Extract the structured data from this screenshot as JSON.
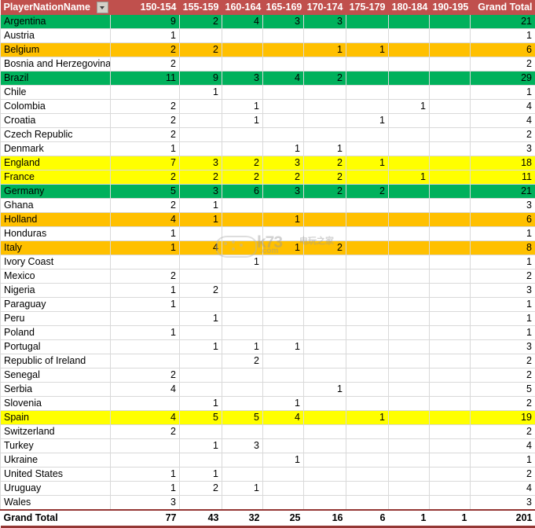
{
  "header": {
    "name_label": "PlayerNationName",
    "filter_icon": "chevron-down-icon",
    "columns": [
      "150-154",
      "155-159",
      "160-164",
      "165-169",
      "170-174",
      "175-179",
      "180-184",
      "190-195"
    ],
    "grand_total_label": "Grand Total",
    "bg_color": "#c0504d",
    "text_color": "#ffffff"
  },
  "highlight_colors": {
    "green": "#00b15c",
    "orange": "#ffc000",
    "yellow": "#ffff00",
    "none": "#ffffff"
  },
  "watermark": {
    "text": "k73",
    "sub": ".com",
    "cn": "电玩之家"
  },
  "chart_data": {
    "type": "table",
    "title": "PlayerNationName by height band",
    "categories": [
      "150-154",
      "155-159",
      "160-164",
      "165-169",
      "170-174",
      "175-179",
      "180-184",
      "190-195"
    ],
    "row_label": "PlayerNationName",
    "total_label": "Grand Total",
    "grand_total_row": {
      "name": "Grand Total",
      "values": [
        "77",
        "43",
        "32",
        "25",
        "16",
        "6",
        "1",
        "1"
      ],
      "total": "201"
    },
    "rows": [
      {
        "name": "Argentina",
        "highlight": "green",
        "values": [
          "9",
          "2",
          "4",
          "3",
          "3",
          "",
          "",
          ""
        ],
        "total": "21"
      },
      {
        "name": "Austria",
        "highlight": "none",
        "values": [
          "1",
          "",
          "",
          "",
          "",
          "",
          "",
          ""
        ],
        "total": "1"
      },
      {
        "name": "Belgium",
        "highlight": "orange",
        "values": [
          "2",
          "2",
          "",
          "",
          "1",
          "1",
          "",
          ""
        ],
        "total": "6"
      },
      {
        "name": "Bosnia and Herzegovina",
        "highlight": "none",
        "values": [
          "2",
          "",
          "",
          "",
          "",
          "",
          "",
          ""
        ],
        "total": "2"
      },
      {
        "name": "Brazil",
        "highlight": "green",
        "values": [
          "11",
          "9",
          "3",
          "4",
          "2",
          "",
          "",
          ""
        ],
        "total": "29"
      },
      {
        "name": "Chile",
        "highlight": "none",
        "values": [
          "",
          "1",
          "",
          "",
          "",
          "",
          "",
          ""
        ],
        "total": "1"
      },
      {
        "name": "Colombia",
        "highlight": "none",
        "values": [
          "2",
          "",
          "1",
          "",
          "",
          "",
          "1",
          ""
        ],
        "total": "4"
      },
      {
        "name": "Croatia",
        "highlight": "none",
        "values": [
          "2",
          "",
          "1",
          "",
          "",
          "1",
          "",
          ""
        ],
        "total": "4"
      },
      {
        "name": "Czech Republic",
        "highlight": "none",
        "values": [
          "2",
          "",
          "",
          "",
          "",
          "",
          "",
          ""
        ],
        "total": "2"
      },
      {
        "name": "Denmark",
        "highlight": "none",
        "values": [
          "1",
          "",
          "",
          "1",
          "1",
          "",
          "",
          ""
        ],
        "total": "3"
      },
      {
        "name": "England",
        "highlight": "yellow",
        "values": [
          "7",
          "3",
          "2",
          "3",
          "2",
          "1",
          "",
          ""
        ],
        "total": "18"
      },
      {
        "name": "France",
        "highlight": "yellow",
        "values": [
          "2",
          "2",
          "2",
          "2",
          "2",
          "",
          "1",
          ""
        ],
        "total": "11"
      },
      {
        "name": "Germany",
        "highlight": "green",
        "values": [
          "5",
          "3",
          "6",
          "3",
          "2",
          "2",
          "",
          ""
        ],
        "total": "21"
      },
      {
        "name": "Ghana",
        "highlight": "none",
        "values": [
          "2",
          "1",
          "",
          "",
          "",
          "",
          "",
          ""
        ],
        "total": "3"
      },
      {
        "name": "Holland",
        "highlight": "orange",
        "values": [
          "4",
          "1",
          "",
          "1",
          "",
          "",
          "",
          ""
        ],
        "total": "6"
      },
      {
        "name": "Honduras",
        "highlight": "none",
        "values": [
          "1",
          "",
          "",
          "",
          "",
          "",
          "",
          ""
        ],
        "total": "1"
      },
      {
        "name": "Italy",
        "highlight": "orange",
        "values": [
          "1",
          "4",
          "",
          "1",
          "2",
          "",
          "",
          ""
        ],
        "total": "8"
      },
      {
        "name": "Ivory Coast",
        "highlight": "none",
        "values": [
          "",
          "",
          "1",
          "",
          "",
          "",
          "",
          ""
        ],
        "total": "1"
      },
      {
        "name": "Mexico",
        "highlight": "none",
        "values": [
          "2",
          "",
          "",
          "",
          "",
          "",
          "",
          ""
        ],
        "total": "2"
      },
      {
        "name": "Nigeria",
        "highlight": "none",
        "values": [
          "1",
          "2",
          "",
          "",
          "",
          "",
          "",
          ""
        ],
        "total": "3"
      },
      {
        "name": "Paraguay",
        "highlight": "none",
        "values": [
          "1",
          "",
          "",
          "",
          "",
          "",
          "",
          ""
        ],
        "total": "1"
      },
      {
        "name": "Peru",
        "highlight": "none",
        "values": [
          "",
          "1",
          "",
          "",
          "",
          "",
          "",
          ""
        ],
        "total": "1"
      },
      {
        "name": "Poland",
        "highlight": "none",
        "values": [
          "1",
          "",
          "",
          "",
          "",
          "",
          "",
          ""
        ],
        "total": "1"
      },
      {
        "name": "Portugal",
        "highlight": "none",
        "values": [
          "",
          "1",
          "1",
          "1",
          "",
          "",
          "",
          ""
        ],
        "total": "3"
      },
      {
        "name": "Republic of Ireland",
        "highlight": "none",
        "values": [
          "",
          "",
          "2",
          "",
          "",
          "",
          "",
          ""
        ],
        "total": "2"
      },
      {
        "name": "Senegal",
        "highlight": "none",
        "values": [
          "2",
          "",
          "",
          "",
          "",
          "",
          "",
          ""
        ],
        "total": "2"
      },
      {
        "name": "Serbia",
        "highlight": "none",
        "values": [
          "4",
          "",
          "",
          "",
          "1",
          "",
          "",
          ""
        ],
        "total": "5"
      },
      {
        "name": "Slovenia",
        "highlight": "none",
        "values": [
          "",
          "1",
          "",
          "1",
          "",
          "",
          "",
          ""
        ],
        "total": "2"
      },
      {
        "name": "Spain",
        "highlight": "yellow",
        "values": [
          "4",
          "5",
          "5",
          "4",
          "",
          "1",
          "",
          ""
        ],
        "total": "19"
      },
      {
        "name": "Switzerland",
        "highlight": "none",
        "values": [
          "2",
          "",
          "",
          "",
          "",
          "",
          "",
          ""
        ],
        "total": "2"
      },
      {
        "name": "Turkey",
        "highlight": "none",
        "values": [
          "",
          "1",
          "3",
          "",
          "",
          "",
          "",
          ""
        ],
        "total": "4"
      },
      {
        "name": "Ukraine",
        "highlight": "none",
        "values": [
          "",
          "",
          "",
          "1",
          "",
          "",
          "",
          ""
        ],
        "total": "1"
      },
      {
        "name": "United States",
        "highlight": "none",
        "values": [
          "1",
          "1",
          "",
          "",
          "",
          "",
          "",
          ""
        ],
        "total": "2"
      },
      {
        "name": "Uruguay",
        "highlight": "none",
        "values": [
          "1",
          "2",
          "1",
          "",
          "",
          "",
          "",
          ""
        ],
        "total": "4"
      },
      {
        "name": "Wales",
        "highlight": "none",
        "values": [
          "3",
          "",
          "",
          "",
          "",
          "",
          "",
          ""
        ],
        "total": "3"
      }
    ]
  }
}
